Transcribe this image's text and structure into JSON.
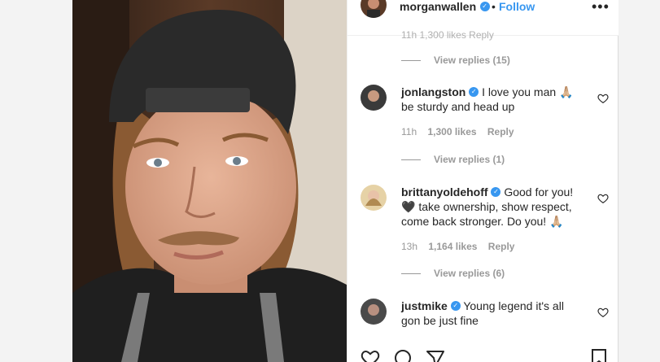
{
  "header": {
    "username": "morganwallen",
    "dot": "•",
    "follow_label": "Follow",
    "more_label": "•••"
  },
  "cut_meta": "11h 1,300 likes Reply",
  "top_replies": "View replies (15)",
  "comments": [
    {
      "username": "jonlangston",
      "text": "I love you man 🙏🏼 be sturdy and head up",
      "time": "11h",
      "likes": "1,300 likes",
      "reply": "Reply",
      "view_replies": "View replies (1)"
    },
    {
      "username": "brittanyoldehoff",
      "text": "Good for you! 🖤 take ownership, show respect, come back stronger. Do you! 🙏🏼",
      "time": "13h",
      "likes": "1,164 likes",
      "reply": "Reply",
      "view_replies": "View replies (6)"
    },
    {
      "username": "justmike",
      "text": "Young legend it's all gon be just fine"
    }
  ],
  "colors": {
    "verified": "#3897f0",
    "follow": "#3897f0",
    "meta": "#999999",
    "text": "#262626"
  },
  "icons": [
    "verified-badge-icon",
    "more-options-icon",
    "heart-icon",
    "comment-icon",
    "share-icon",
    "bookmark-icon"
  ]
}
